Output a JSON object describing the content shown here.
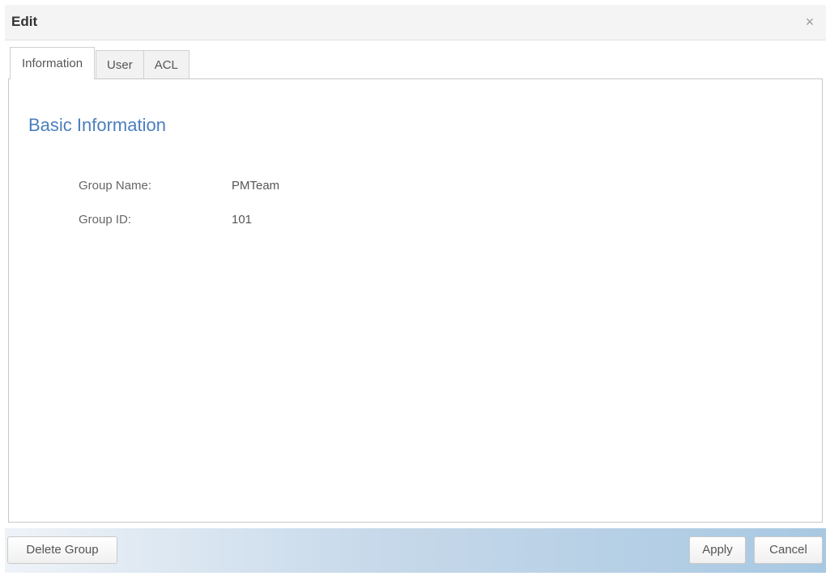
{
  "dialog": {
    "title": "Edit",
    "close_icon": "close-icon",
    "close_glyph": "×"
  },
  "tabs": [
    {
      "label": "Information",
      "active": true
    },
    {
      "label": "User",
      "active": false
    },
    {
      "label": "ACL",
      "active": false
    }
  ],
  "content": {
    "section_title": "Basic Information",
    "fields": [
      {
        "label": "Group Name:",
        "value": "PMTeam"
      },
      {
        "label": "Group ID:",
        "value": "101"
      }
    ]
  },
  "footer": {
    "delete_label": "Delete Group",
    "apply_label": "Apply",
    "cancel_label": "Cancel"
  },
  "colors": {
    "accent_heading": "#4a7fbd",
    "footer_gradient_start": "#eef3f8",
    "footer_gradient_end": "#a8c8e2"
  }
}
